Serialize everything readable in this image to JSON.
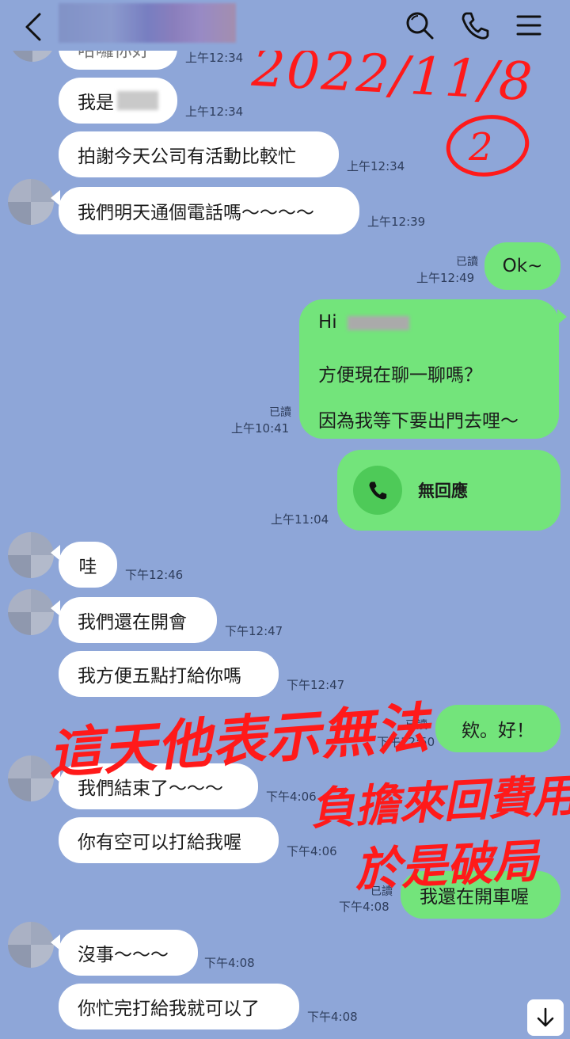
{
  "header": {
    "title": "",
    "icons": [
      "back-arrow-icon",
      "search-icon",
      "phone-icon",
      "menu-icon"
    ]
  },
  "messages": [
    {
      "id": "m0",
      "side": "left",
      "text": "哈囉你好",
      "time": "上午12:34"
    },
    {
      "id": "m1",
      "side": "left",
      "text": "我是",
      "time": "上午12:34"
    },
    {
      "id": "m2",
      "side": "left",
      "text": "拍謝今天公司有活動比較忙",
      "time": "上午12:34"
    },
    {
      "id": "m3",
      "side": "left",
      "text": "我們明天通個電話嗎～～～～",
      "time": "上午12:39"
    },
    {
      "id": "m4",
      "side": "right",
      "text": "Ok~",
      "read": "已讀",
      "time": "上午12:49"
    },
    {
      "id": "m5",
      "side": "right",
      "lines": [
        "Hi",
        "方便現在聊一聊嗎？",
        "因為我等下要出門去哩～"
      ],
      "read": "已讀",
      "time": "上午10:41"
    },
    {
      "id": "m6",
      "side": "right",
      "type": "call",
      "text": "無回應",
      "time": "上午11:04"
    },
    {
      "id": "m7",
      "side": "left",
      "text": "哇",
      "time": "下午12:46"
    },
    {
      "id": "m8",
      "side": "left",
      "text": "我們還在開會",
      "time": "下午12:47"
    },
    {
      "id": "m9",
      "side": "left",
      "text": "我方便五點打給你嗎",
      "time": "下午12:47"
    },
    {
      "id": "m10",
      "side": "right",
      "text": "欸。好！",
      "read": "已讀",
      "time": "下午12:50"
    },
    {
      "id": "m11",
      "side": "left",
      "text": "我們結束了～～～",
      "time": "下午4:06"
    },
    {
      "id": "m12",
      "side": "left",
      "text": "你有空可以打給我喔",
      "time": "下午4:06"
    },
    {
      "id": "m13",
      "side": "right",
      "text": "我還在開車喔",
      "read": "已讀",
      "time": "下午4:08"
    },
    {
      "id": "m14",
      "side": "left",
      "text": "沒事～～～",
      "time": "下午4:08"
    },
    {
      "id": "m15",
      "side": "left",
      "text": "你忙完打給我就可以了",
      "time": "下午4:08"
    }
  ],
  "annotations": {
    "date": "2022/11/8",
    "number": "2",
    "note_lines": [
      "這天他表示無法",
      "負擔來回費用",
      "於是破局"
    ]
  },
  "colors": {
    "background": "#8ea6d8",
    "bubble_in": "#ffffff",
    "bubble_out": "#73e47b",
    "ink": "#ff1a1a"
  }
}
